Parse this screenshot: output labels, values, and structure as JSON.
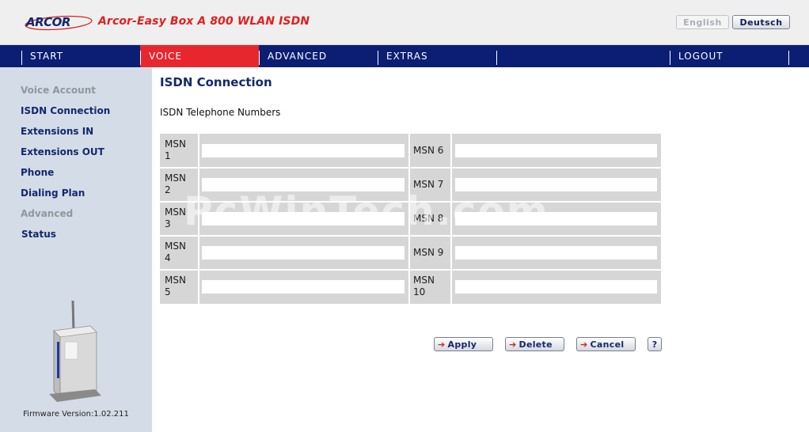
{
  "header": {
    "logo_text": "ARCOR",
    "product_title": "Arcor-Easy Box A 800 WLAN ISDN",
    "languages": [
      "English",
      "Deutsch"
    ]
  },
  "nav": {
    "items": [
      "START",
      "VOICE",
      "ADVANCED",
      "EXTRAS",
      "LOGOUT"
    ],
    "active": "VOICE"
  },
  "sidebar": {
    "items": [
      "Voice Account",
      "ISDN Connection",
      "Extensions IN",
      "Extensions OUT",
      "Phone",
      "Dialing Plan",
      "Advanced",
      "Status"
    ],
    "firmware": "Firmware Version:1.02.211"
  },
  "main": {
    "title": "ISDN Connection",
    "subtitle": "ISDN Telephone Numbers",
    "msn": [
      {
        "l1": "MSN",
        "l2": "1",
        "value": ""
      },
      {
        "l1": "MSN",
        "l2": "2",
        "value": ""
      },
      {
        "l1": "MSN",
        "l2": "3",
        "value": ""
      },
      {
        "l1": "MSN",
        "l2": "4",
        "value": ""
      },
      {
        "l1": "MSN",
        "l2": "5",
        "value": ""
      },
      {
        "l1": "MSN 6",
        "l2": "",
        "value": ""
      },
      {
        "l1": "MSN 7",
        "l2": "",
        "value": ""
      },
      {
        "l1": "MSN 8",
        "l2": "",
        "value": ""
      },
      {
        "l1": "MSN 9",
        "l2": "",
        "value": ""
      },
      {
        "l1": "MSN",
        "l2": "10",
        "value": ""
      }
    ]
  },
  "buttons": {
    "apply": "Apply",
    "delete": "Delete",
    "cancel": "Cancel",
    "help": "?"
  },
  "watermark": "PcWinTech.com",
  "colors": {
    "nav_bg": "#0b1e73",
    "nav_active": "#e8262e",
    "sidebar_bg": "#d4dde7",
    "title_red": "#e02020",
    "link_blue": "#13286e"
  }
}
